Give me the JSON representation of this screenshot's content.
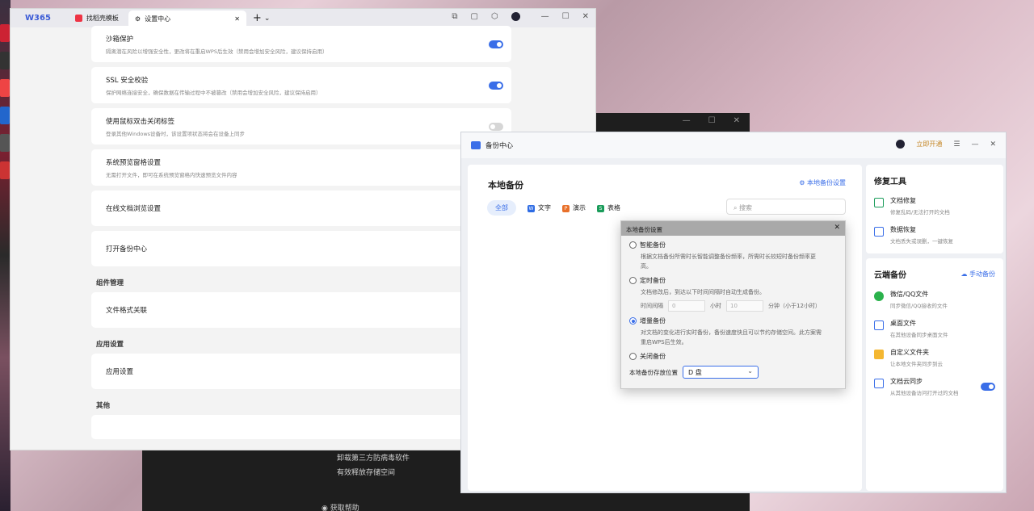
{
  "settings_window": {
    "logo": "W365",
    "tabs": [
      {
        "label": "找稻壳模板"
      },
      {
        "label": "设置中心"
      }
    ],
    "add_tab": "+",
    "cards_top": [
      {
        "title": "沙箱保护",
        "desc": "隔离潜在风险以增强安全性，更改将在重启WPS后生效（禁用会增加安全风险，建议保持启用）",
        "toggle": true
      },
      {
        "title": "SSL 安全校验",
        "desc": "保护网络连接安全，确保数据在传输过程中不被篡改（禁用会增加安全风险，建议保持启用）",
        "toggle": true
      },
      {
        "title": "使用鼠标双击关闭标签",
        "desc": "登录其他Windows设备时，该设置项状态将会在设备上同步",
        "toggle": false
      },
      {
        "title": "系统预览窗格设置",
        "desc": "无需打开文件，即可在系统预览窗格内快速预览文件内容"
      },
      {
        "title": "在线文档浏览设置"
      },
      {
        "title": "打开备份中心"
      }
    ],
    "section_components": "组件管理",
    "file_assoc": "文件格式关联",
    "section_app": "应用设置",
    "app_settings": "应用设置",
    "section_other": "其他"
  },
  "dark_window": {
    "items": [
      "卸载第三方防病毒软件",
      "有效释放存储空间",
      "获取帮助"
    ]
  },
  "backup_window": {
    "title": "备份中心",
    "open_now": "立即开通",
    "local_backup": "本地备份",
    "local_settings": "本地备份设置",
    "filters": [
      "全部",
      "文字",
      "演示",
      "表格"
    ],
    "search_placeholder": "搜索",
    "repair_tools": "修复工具",
    "repair_items": [
      {
        "title": "文档修复",
        "desc": "修复乱码/无法打开的文档"
      },
      {
        "title": "数据恢复",
        "desc": "文档丢失或误删，一键恢复"
      }
    ],
    "cloud_backup": "云端备份",
    "manual_backup": "手动备份",
    "cloud_items": [
      {
        "title": "微信/QQ文件",
        "desc": "同步微信/QQ接收的文件"
      },
      {
        "title": "桌面文件",
        "desc": "在其他设备同步桌面文件"
      },
      {
        "title": "自定义文件夹",
        "desc": "让本地文件夹同步到云"
      },
      {
        "title": "文档云同步",
        "desc": "从其他设备访问打开过的文档"
      }
    ]
  },
  "dialog": {
    "title": "本地备份设置",
    "smart": "智能备份",
    "smart_desc": "根据文档备份所需时长智能调整备份频率，所需时长较短时备份频率更高。",
    "timed": "定时备份",
    "timed_desc": "文档修改后，到达以下时间间隔时自动生成备份。",
    "interval_label": "时间间隔",
    "hours_value": "0",
    "hours_unit": "小时",
    "minutes_value": "10",
    "minutes_unit": "分钟（小于12小时）",
    "incremental": "增量备份",
    "incremental_desc": "对文档的变化进行实时备份，备份速度快且可以节约存储空间。此方案需重启WPS后生效。",
    "close_backup": "关闭备份",
    "location_label": "本地备份存放位置",
    "location_value": "D 盘"
  }
}
